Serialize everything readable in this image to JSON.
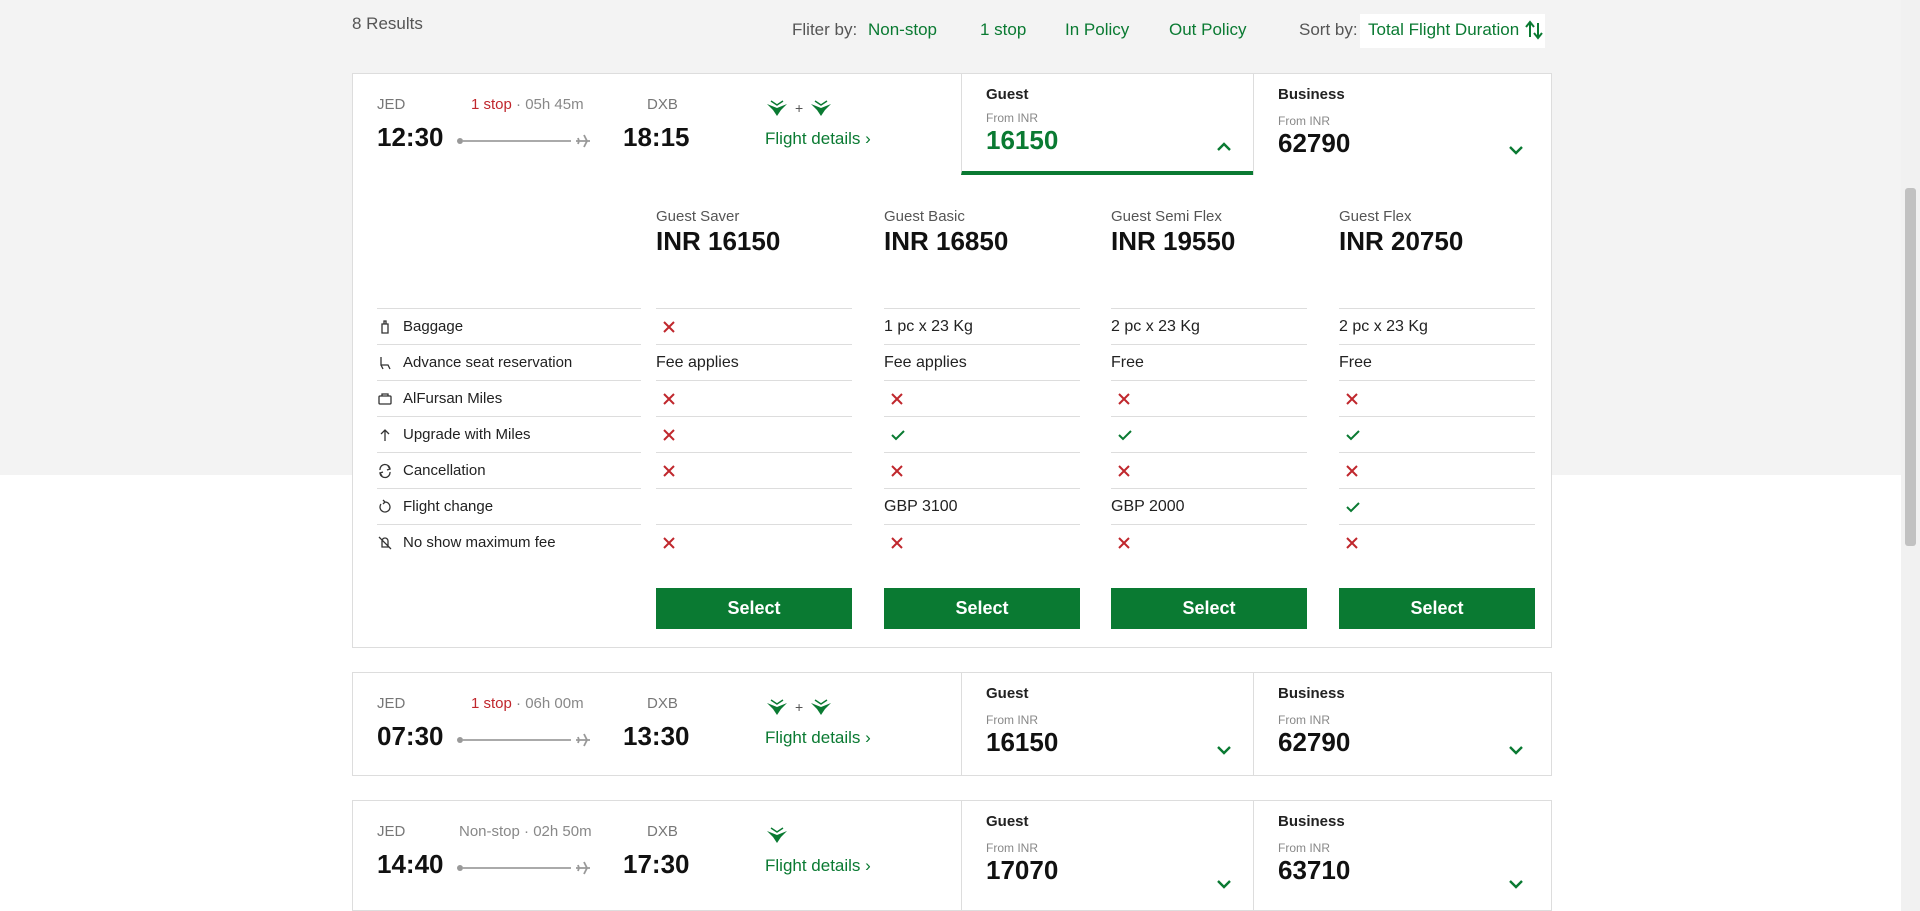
{
  "results": {
    "count_label": "8 Results"
  },
  "filter": {
    "label": "Fliter by:",
    "options": [
      "Non-stop",
      "1 stop",
      "In Policy",
      "Out Policy"
    ]
  },
  "sort": {
    "label": "Sort by:",
    "value": "Total Flight Duration"
  },
  "colors": {
    "accent": "#0a7a32",
    "stop_red": "#c0272d",
    "x_red": "#c0272d"
  },
  "flights": [
    {
      "origin": "JED",
      "dep_time": "12:30",
      "dest": "DXB",
      "arr_time": "18:15",
      "stops": "1 stop",
      "duration": " · 05h 45m",
      "details_label": "Flight details",
      "guest": {
        "title": "Guest",
        "from": "From INR",
        "price": "16150"
      },
      "business": {
        "title": "Business",
        "from": "From INR",
        "price": "62790"
      }
    },
    {
      "origin": "JED",
      "dep_time": "07:30",
      "dest": "DXB",
      "arr_time": "13:30",
      "stops": "1 stop",
      "duration": " · 06h 00m",
      "details_label": "Flight details",
      "guest": {
        "title": "Guest",
        "from": "From INR",
        "price": "16150"
      },
      "business": {
        "title": "Business",
        "from": "From INR",
        "price": "62790"
      }
    },
    {
      "origin": "JED",
      "dep_time": "14:40",
      "dest": "DXB",
      "arr_time": "17:30",
      "stops": "Non-stop",
      "duration": " · 02h 50m",
      "details_label": "Flight details",
      "guest": {
        "title": "Guest",
        "from": "From INR",
        "price": "17070"
      },
      "business": {
        "title": "Business",
        "from": "From INR",
        "price": "63710"
      }
    }
  ],
  "fares": [
    {
      "name": "Guest Saver",
      "price": "INR 16150"
    },
    {
      "name": "Guest Basic",
      "price": "INR 16850"
    },
    {
      "name": "Guest Semi Flex",
      "price": "INR 19550"
    },
    {
      "name": "Guest Flex",
      "price": "INR 20750"
    }
  ],
  "features": [
    {
      "label": "Baggage",
      "icon": "baggage-icon",
      "values": [
        "x",
        "1 pc x 23 Kg",
        "2 pc x 23 Kg",
        "2 pc x 23 Kg"
      ]
    },
    {
      "label": "Advance seat reservation",
      "icon": "seat-icon",
      "values": [
        "Fee applies",
        "Fee applies",
        "Free",
        "Free"
      ]
    },
    {
      "label": "AlFursan Miles",
      "icon": "miles-icon",
      "values": [
        "x",
        "x",
        "x",
        "x"
      ]
    },
    {
      "label": "Upgrade with Miles",
      "icon": "upgrade-icon",
      "values": [
        "x",
        "check",
        "check",
        "check"
      ]
    },
    {
      "label": "Cancellation",
      "icon": "cancellation-icon",
      "values": [
        "x",
        "x",
        "x",
        "x"
      ]
    },
    {
      "label": "Flight change",
      "icon": "flight-change-icon",
      "values": [
        "",
        "GBP 3100",
        "GBP 2000",
        "check"
      ]
    },
    {
      "label": "No show maximum fee",
      "icon": "no-show-icon",
      "values": [
        "x",
        "x",
        "x",
        "x"
      ]
    }
  ],
  "select_label": "Select"
}
